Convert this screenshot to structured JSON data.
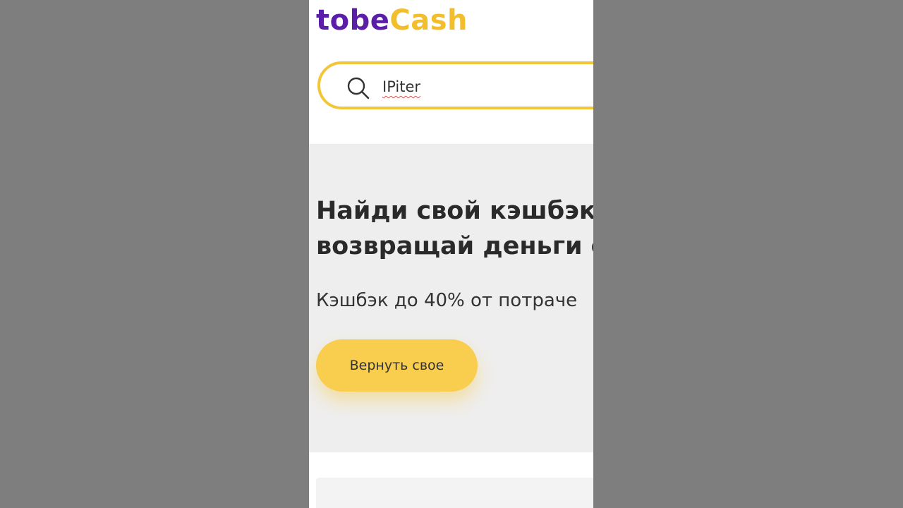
{
  "brand": {
    "logo_part1": "to",
    "logo_part2": "be",
    "logo_part3": "Cash",
    "primary_color": "#5b1ea8",
    "accent_color": "#f3be2b"
  },
  "search": {
    "icon": "search-icon",
    "value": "IPiter"
  },
  "hero": {
    "title_line1": "Найди свой кэшбэк",
    "title_line2": "возвращай деньги с",
    "subtitle": "Кэшбэк до 40% от потраче",
    "cta_label": "Вернуть свое",
    "cta_color": "#f9cd4d"
  }
}
